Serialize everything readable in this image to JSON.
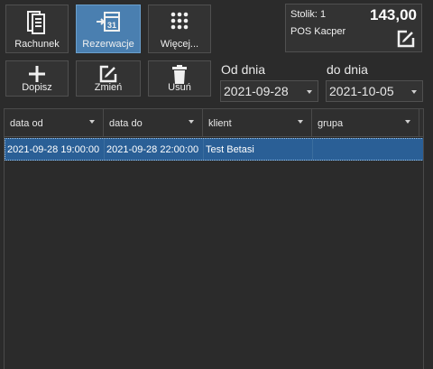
{
  "toolbar": {
    "rachunek": "Rachunek",
    "rezerwacje": "Rezerwacje",
    "wiecej": "Więcej...",
    "calendar_day": "31",
    "dopisz": "Dopisz",
    "zmien": "Zmień",
    "usun": "Usuń"
  },
  "info": {
    "table_label": "Stolik: 1",
    "pos_label": "POS Kacper",
    "amount": "143,00"
  },
  "dates": {
    "from_label": "Od dnia",
    "from_value": "2021-09-28",
    "to_label": "do dnia",
    "to_value": "2021-10-05"
  },
  "grid": {
    "columns": [
      "data od",
      "data do",
      "klient",
      "grupa"
    ],
    "rows": [
      [
        "2021-09-28 19:00:00",
        "2021-09-28 22:00:00",
        "Test Betasi",
        ""
      ]
    ]
  },
  "colors": {
    "active_button": "#4a7fb0",
    "selected_row": "#2a5f96",
    "background": "#2b2b2b"
  }
}
